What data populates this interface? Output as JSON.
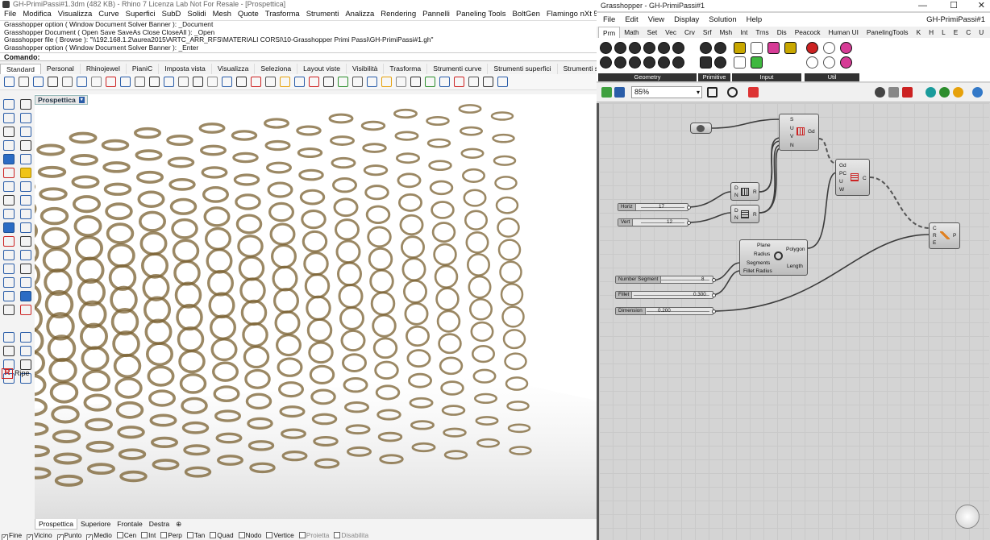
{
  "rhino": {
    "title": "GH-PrimiPassi#1.3dm (482 KB) - Rhino 7 Licenza Lab Not For Resale - [Prospettica]",
    "menu": [
      "File",
      "Modifica",
      "Visualizza",
      "Curve",
      "Superfici",
      "SubD",
      "Solidi",
      "Mesh",
      "Quote",
      "Trasforma",
      "Strumenti",
      "Analizza",
      "Rendering",
      "Pannelli",
      "Paneling Tools",
      "BoltGen",
      "Flamingo nXt 5.5",
      "Aiuti"
    ],
    "command_history": [
      "Grasshopper option ( Window  Document  Solver  Banner ): _Document",
      "Grasshopper Document ( Open  Save  SaveAs  Close  CloseAll ): _Open",
      "Grasshopper file ( Browse ): \"\\\\192.168.1.2\\aurea2015\\ARTC_ARR_RFS\\MATERIALI CORSI\\10-Grasshopper Primi Passi\\GH-PrimiPassi#1.gh\"",
      "Grasshopper option ( Window  Document  Solver  Banner ): _Enter"
    ],
    "command_prompt": "Comando:",
    "toolbar_tabs": [
      "Standard",
      "Personal",
      "Rhinojewel",
      "PianiC",
      "Imposta vista",
      "Visualizza",
      "Seleziona",
      "Layout viste",
      "Visibilità",
      "Trasforma",
      "Strumenti curve",
      "Strumenti superfici",
      "Strumenti solidi",
      "Strumenti SubD"
    ],
    "viewport_label": "Prospettica",
    "viewport_label_arrow": "▾",
    "left_panel_ripe": "Ripe",
    "left_panel_ripe_icon": "R",
    "viewport_tabs": [
      "Prospettica",
      "Superiore",
      "Frontale",
      "Destra",
      "⊕"
    ],
    "osnaps": [
      {
        "label": "Fine",
        "checked": true,
        "enabled": true
      },
      {
        "label": "Vicino",
        "checked": true,
        "enabled": true
      },
      {
        "label": "Punto",
        "checked": true,
        "enabled": true
      },
      {
        "label": "Medio",
        "checked": true,
        "enabled": true
      },
      {
        "label": "Cen",
        "checked": false,
        "enabled": true
      },
      {
        "label": "Int",
        "checked": false,
        "enabled": true
      },
      {
        "label": "Perp",
        "checked": false,
        "enabled": true
      },
      {
        "label": "Tan",
        "checked": false,
        "enabled": true
      },
      {
        "label": "Quad",
        "checked": false,
        "enabled": true
      },
      {
        "label": "Nodo",
        "checked": false,
        "enabled": true
      },
      {
        "label": "Vertice",
        "checked": false,
        "enabled": true
      },
      {
        "label": "Proietta",
        "checked": false,
        "enabled": false
      },
      {
        "label": "Disabilita",
        "checked": false,
        "enabled": false
      }
    ],
    "colors": {
      "mesh_tube": "#7a6030",
      "background": "#ffffff"
    }
  },
  "grasshopper": {
    "title": "Grasshopper - GH-PrimiPassi#1",
    "window_controls": [
      "—",
      "☐",
      "✕"
    ],
    "menu": [
      "File",
      "Edit",
      "View",
      "Display",
      "Solution",
      "Help"
    ],
    "document_name": "GH-PrimiPassi#1",
    "tabs": [
      "Prm",
      "Math",
      "Set",
      "Vec",
      "Crv",
      "Srf",
      "Msh",
      "Int",
      "Trns",
      "Dis",
      "Peacock",
      "Human UI",
      "PanelingTools",
      "K",
      "H",
      "L",
      "E",
      "C",
      "U"
    ],
    "ribbon_groups": [
      "Geometry",
      "Primitive",
      "Input",
      "Util"
    ],
    "zoom": "85%",
    "zoom_arrow": "▾",
    "components": {
      "divide_domain2": {
        "icon": "Gd",
        "inputs": [
          "S",
          "U",
          "V",
          "N"
        ]
      },
      "map_curves": {
        "icon": "C",
        "inputs": [
          "Gd",
          "PC",
          "U",
          "W"
        ]
      },
      "construct_domain_1": {
        "inputs": [
          "D",
          "N"
        ],
        "output": "R"
      },
      "construct_domain_2": {
        "inputs": [
          "D",
          "N"
        ],
        "output": "R"
      },
      "polygon": {
        "inputs": [
          "Plane",
          "Radius",
          "Segments",
          "Fillet Radius"
        ],
        "outputs": [
          "Polygon",
          "Length"
        ]
      },
      "pipe": {
        "inputs": [
          "C",
          "R",
          "E"
        ],
        "output": "P"
      }
    },
    "sliders": [
      {
        "name": "Horiz",
        "value": "17"
      },
      {
        "name": "Vert",
        "value": "12"
      },
      {
        "name": "Number Segment",
        "value": "8"
      },
      {
        "name": "Fillet",
        "value": "0.300"
      },
      {
        "name": "Dimension",
        "value": "0.200"
      }
    ]
  }
}
